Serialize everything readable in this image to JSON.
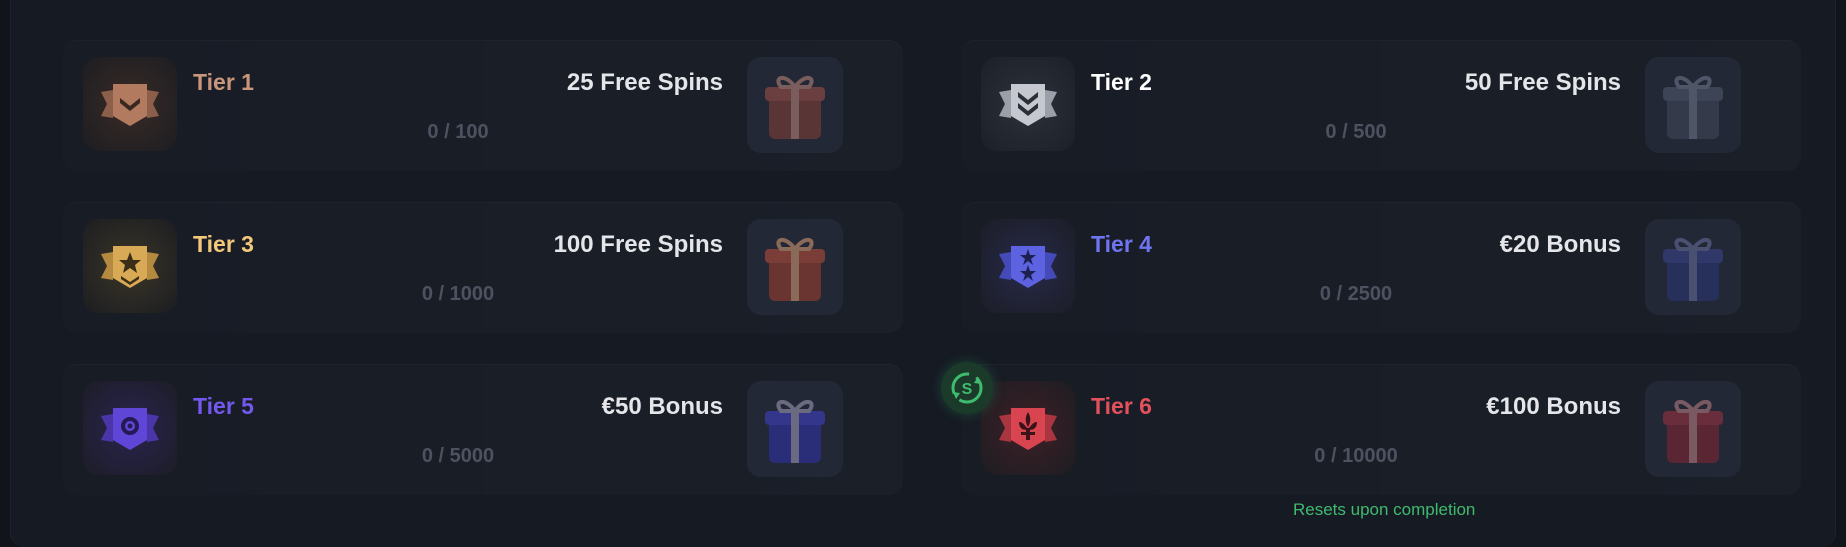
{
  "tiers": [
    {
      "title": "Tier 1",
      "reward": "25 Free Spins",
      "progress": "0 / 100",
      "color": "#c9967c",
      "badge_color": "#a9735b",
      "gift_color": "#5a3536",
      "badge_icon": "bronze-chevron-icon"
    },
    {
      "title": "Tier 2",
      "reward": "50 Free Spins",
      "progress": "0 / 500",
      "color": "#ffffff",
      "badge_color": "#c5c8cf",
      "gift_color": "#343a4a",
      "badge_icon": "silver-double-chevron-icon"
    },
    {
      "title": "Tier 3",
      "reward": "100 Free Spins",
      "progress": "0 / 1000",
      "color": "#f3c87a",
      "badge_color": "#d9aa55",
      "gift_color": "#6a3430",
      "badge_icon": "gold-star-icon"
    },
    {
      "title": "Tier 4",
      "reward": "€20 Bonus",
      "progress": "0 / 2500",
      "color": "#6f74f0",
      "badge_color": "#5c62e0",
      "gift_color": "#27305a",
      "badge_icon": "blue-two-stars-icon"
    },
    {
      "title": "Tier 5",
      "reward": "€50 Bonus",
      "progress": "0 / 5000",
      "color": "#7358ee",
      "badge_color": "#6046d6",
      "gift_color": "#2a2d78",
      "badge_icon": "purple-gem-icon"
    },
    {
      "title": "Tier 6",
      "reward": "€100 Bonus",
      "progress": "0 / 10000",
      "color": "#e4505c",
      "badge_color": "#d8444f",
      "gift_color": "#5a2633",
      "badge_icon": "red-fleur-de-lis-icon"
    }
  ],
  "reset": {
    "note": "Resets upon completion",
    "icon": "reset-cycle-icon",
    "color": "#3fbb6f"
  }
}
